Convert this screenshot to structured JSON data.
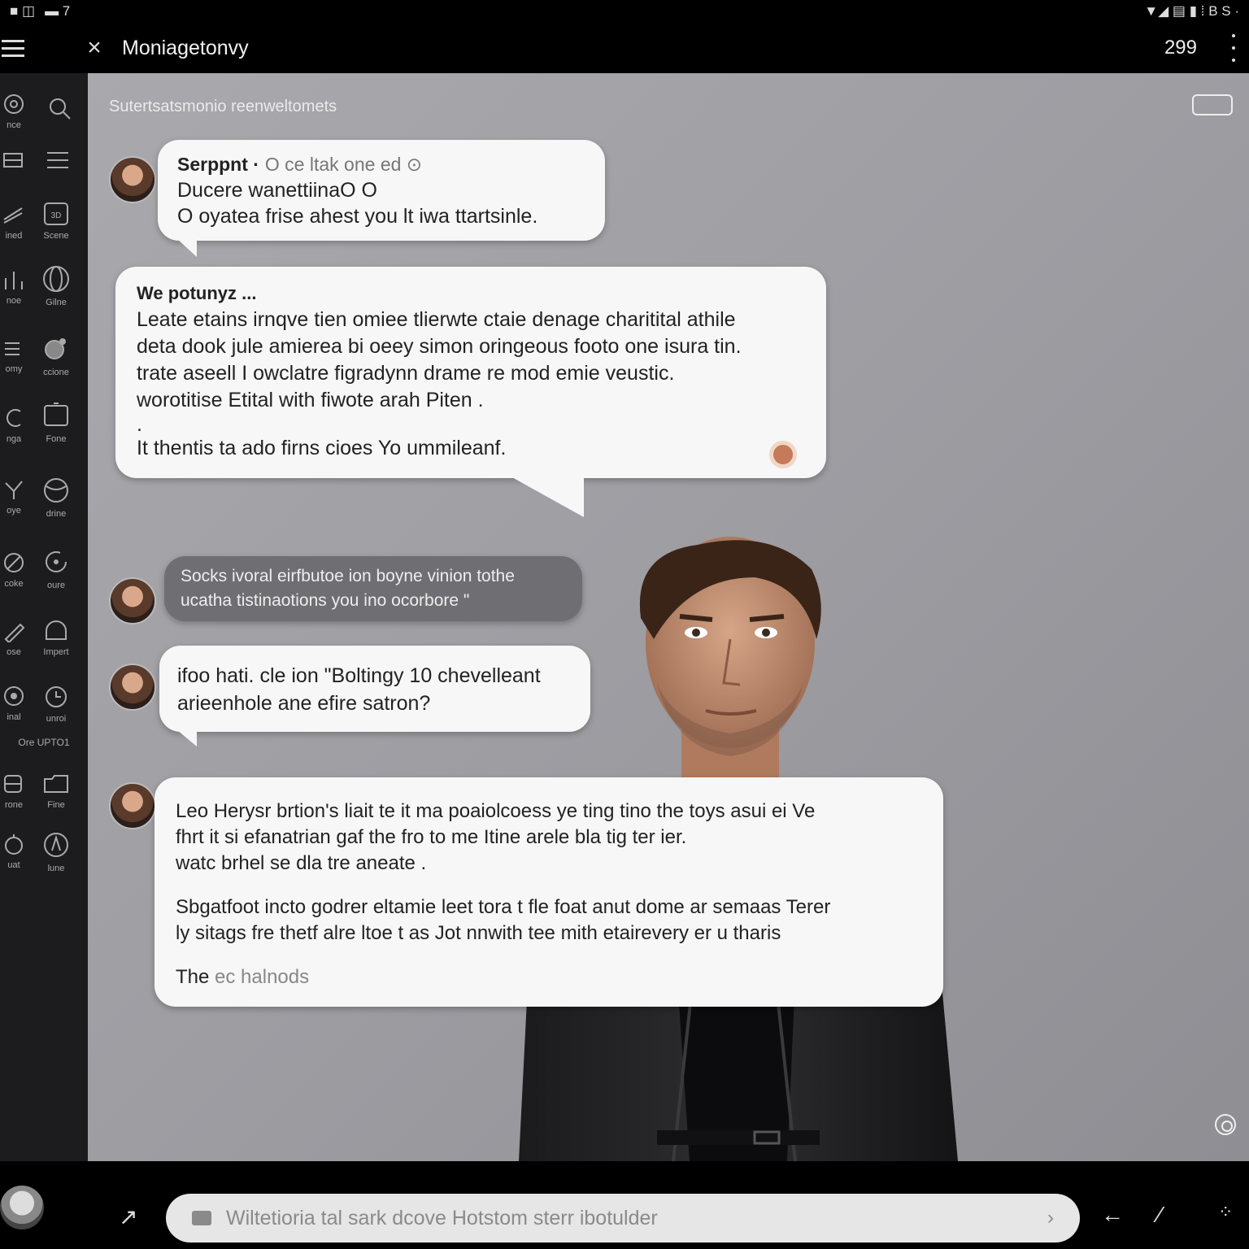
{
  "statusbar": {
    "left": [
      "■ ◫",
      "▬ 7"
    ],
    "right": "▼◢ ▤ ▮ ⁞ B S ·"
  },
  "appbar": {
    "title": "Moniagetonvy",
    "count": "299"
  },
  "conversation": {
    "header": "Sutertsatsmonio reenweltomets"
  },
  "sidebar": {
    "items": [
      {
        "label": "nce",
        "icon": "at-icon"
      },
      {
        "label": "",
        "icon": "search-icon"
      },
      {
        "label": "",
        "icon": "list-icon"
      },
      {
        "label": "",
        "icon": "lines-icon"
      },
      {
        "label": "ined",
        "icon": "stack-icon"
      },
      {
        "label": "Scene",
        "icon": "frame-icon"
      },
      {
        "label": "noe",
        "icon": "chart-icon"
      },
      {
        "label": "Gilne",
        "icon": "globe-icon"
      },
      {
        "label": "omy",
        "icon": "menu-icon"
      },
      {
        "label": "ccione",
        "icon": "bird-icon"
      },
      {
        "label": "nga",
        "icon": "clip-icon"
      },
      {
        "label": "Fone",
        "icon": "tv-icon"
      },
      {
        "label": "oye",
        "icon": "key-icon"
      },
      {
        "label": "drine",
        "icon": "ball-icon"
      },
      {
        "label": "coke",
        "icon": "ring-icon"
      },
      {
        "label": "oure",
        "icon": "refresh-icon"
      },
      {
        "label": "ose",
        "icon": "pen-icon"
      },
      {
        "label": "Impert",
        "icon": "bag-icon"
      },
      {
        "label": "inal",
        "icon": "pin-icon"
      },
      {
        "label": "unroi",
        "icon": "clock-icon"
      },
      {
        "label": "Ore UPTO1",
        "icon": ""
      },
      {
        "label": "rone",
        "icon": "bus-icon"
      },
      {
        "label": "Fine",
        "icon": "folder-icon"
      },
      {
        "label": "uat",
        "icon": "timer-icon"
      },
      {
        "label": "lune",
        "icon": "compass-icon"
      }
    ]
  },
  "messages": [
    {
      "name": "Serppnt ·",
      "meta": "O ce ltak one ed ⊙",
      "lines": [
        "Ducere wanettiinaO O",
        "O oyatea frise ahest  you lt iwa ttartsinle."
      ]
    },
    {
      "name": "We potunyz ...",
      "lines": [
        "Leate etains irnqve tien omiee tlierwte ctaie denage charitital athile",
        "deta dook jule amierea bi oeey simon oringeous footo one isura tin.",
        "trate aseell I owclatre figradynn drame re mod emie veustic.",
        "worotitise Etital with fiwote arah Piten .",
        "."
      ],
      "last": "It thentis ta ado firns cioes Yo ummileanf."
    },
    {
      "lines": [
        "Socks ivoral eirfbutoe ion boyne vinion tothe",
        "ucatha tistinaotions  you ino ocorbore  \""
      ]
    },
    {
      "lines": [
        "ifoo hati. cle ion \"Boltingy 10 chevelleant",
        "arieenhole ane efire satron?"
      ]
    },
    {
      "lines": [
        "Leo Herysr brtion's liait te it ma poaiolcoess ye ting tino the toys asui ei Ve",
        "fhrt it si efanatrian gaf the fro to me Itine arele bla tig ter ier.",
        "watc brhel se dla tre aneate ."
      ],
      "lines2": [
        "Sbgatfoot incto godrer eltamie leet tora t fle foat anut dome ar semaas Terer",
        "ly sitags fre thetf alre ltoe  t as Jot  nnwith tee  mith etairevery er  u tharis"
      ],
      "fade_prefix": "The",
      "fade_text": " ec halnods"
    }
  ],
  "composer": {
    "placeholder": "Wiltetioria tal sark dcove Hotstom sterr ibotulder"
  },
  "colors": {
    "panel": "#1c1c1f",
    "bubble": "#f7f7f7",
    "dark_bubble": "#6e6e73",
    "accent_dot": "#c57a5a"
  }
}
